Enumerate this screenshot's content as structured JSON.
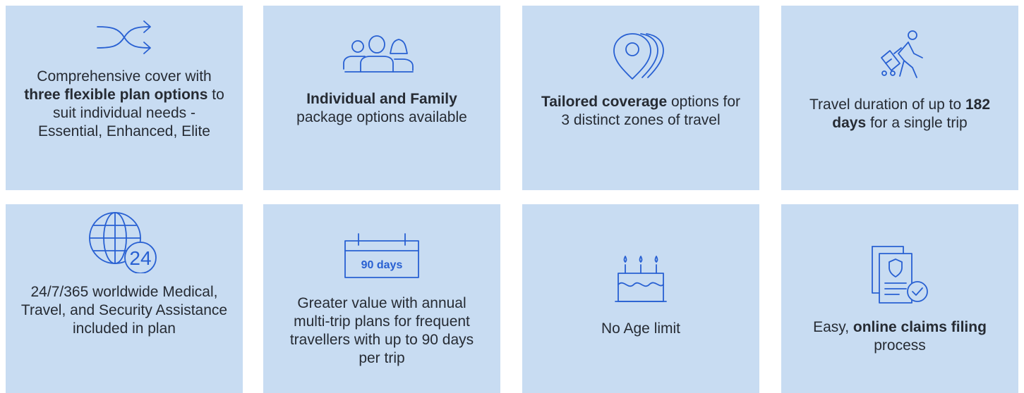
{
  "colors": {
    "card_background": "#c8dcf2",
    "icon_stroke": "#2860d2",
    "text": "#262b33"
  },
  "features": [
    {
      "icon": "shuffle-icon",
      "pre": "Comprehensive cover with ",
      "bold": "three flexible plan options",
      "post": " to suit individual needs - Essential, Enhanced, Elite"
    },
    {
      "icon": "family-icon",
      "pre": "",
      "bold": "Individual and Family",
      "post": " package options available"
    },
    {
      "icon": "map-pins-icon",
      "pre": "",
      "bold": "Tailored coverage",
      "post": " options for 3 distinct zones of travel"
    },
    {
      "icon": "traveller-icon",
      "pre": "Travel duration of up to ",
      "bold": "182 days",
      "post": " for a single trip"
    },
    {
      "icon": "globe-24-icon",
      "icon_label": "24",
      "pre": "24/7/365 worldwide Medical, Travel, and Security Assistance included in plan",
      "bold": "",
      "post": ""
    },
    {
      "icon": "calendar-icon",
      "icon_label": "90 days",
      "pre": "Greater value with annual multi-trip plans for frequent travellers with up to 90 days per trip",
      "bold": "",
      "post": ""
    },
    {
      "icon": "birthday-cake-icon",
      "pre": "No Age limit",
      "bold": "",
      "post": ""
    },
    {
      "icon": "claim-documents-icon",
      "pre": "Easy, ",
      "bold": "online claims filing",
      "post": " process"
    }
  ]
}
